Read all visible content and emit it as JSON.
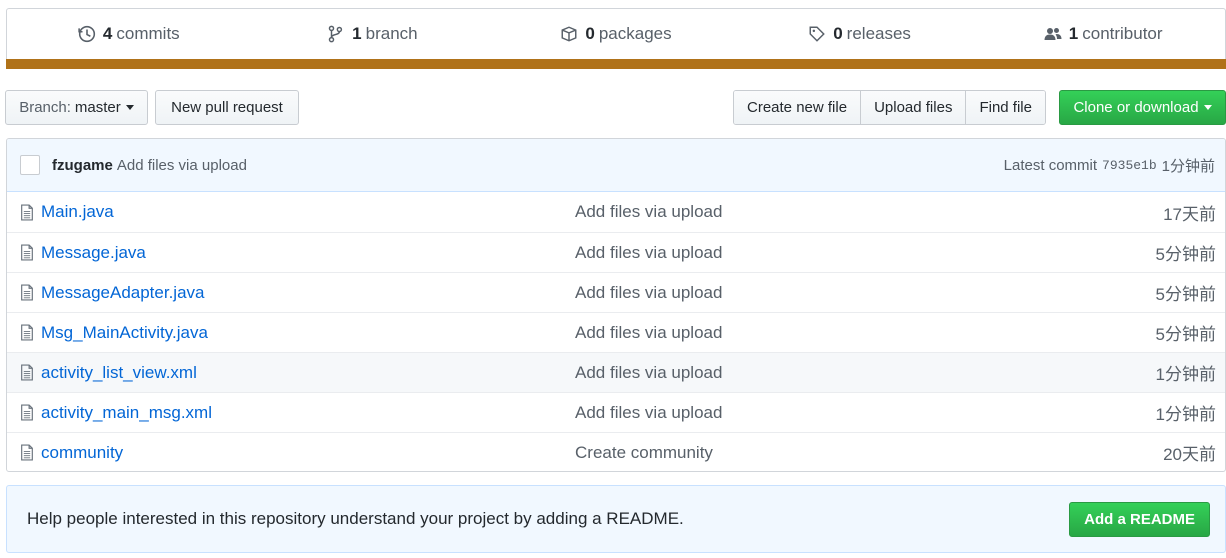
{
  "summary": {
    "commits": {
      "num": "4",
      "label": "commits",
      "icon": "history-icon"
    },
    "branches": {
      "num": "1",
      "label": "branch",
      "icon": "branch-icon"
    },
    "packages": {
      "num": "0",
      "label": "packages",
      "icon": "package-icon"
    },
    "releases": {
      "num": "0",
      "label": "releases",
      "icon": "tag-icon"
    },
    "contributors": {
      "num": "1",
      "label": "contributor",
      "icon": "people-icon"
    },
    "language_color": "#b07219"
  },
  "toolbar": {
    "branch_prefix": "Branch:",
    "branch_name": "master",
    "new_pr": "New pull request",
    "create_file": "Create new file",
    "upload_files": "Upload files",
    "find_file": "Find file",
    "clone": "Clone or download"
  },
  "latest_commit": {
    "author": "fzugame",
    "message": "Add files via upload",
    "label": "Latest commit",
    "sha": "7935e1b",
    "age": "1分钟前"
  },
  "files": [
    {
      "name": "Main.java",
      "message": "Add files via upload",
      "age": "17天前"
    },
    {
      "name": "Message.java",
      "message": "Add files via upload",
      "age": "5分钟前"
    },
    {
      "name": "MessageAdapter.java",
      "message": "Add files via upload",
      "age": "5分钟前"
    },
    {
      "name": "Msg_MainActivity.java",
      "message": "Add files via upload",
      "age": "5分钟前"
    },
    {
      "name": "activity_list_view.xml",
      "message": "Add files via upload",
      "age": "1分钟前"
    },
    {
      "name": "activity_main_msg.xml",
      "message": "Add files via upload",
      "age": "1分钟前"
    },
    {
      "name": "community",
      "message": "Create community",
      "age": "20天前"
    }
  ],
  "readme_prompt": {
    "text": "Help people interested in this repository understand your project by adding a README.",
    "button": "Add a README"
  },
  "colors": {
    "accent_link": "#0366d6",
    "green": "#28a745",
    "tease_bg": "#f1f8ff"
  }
}
